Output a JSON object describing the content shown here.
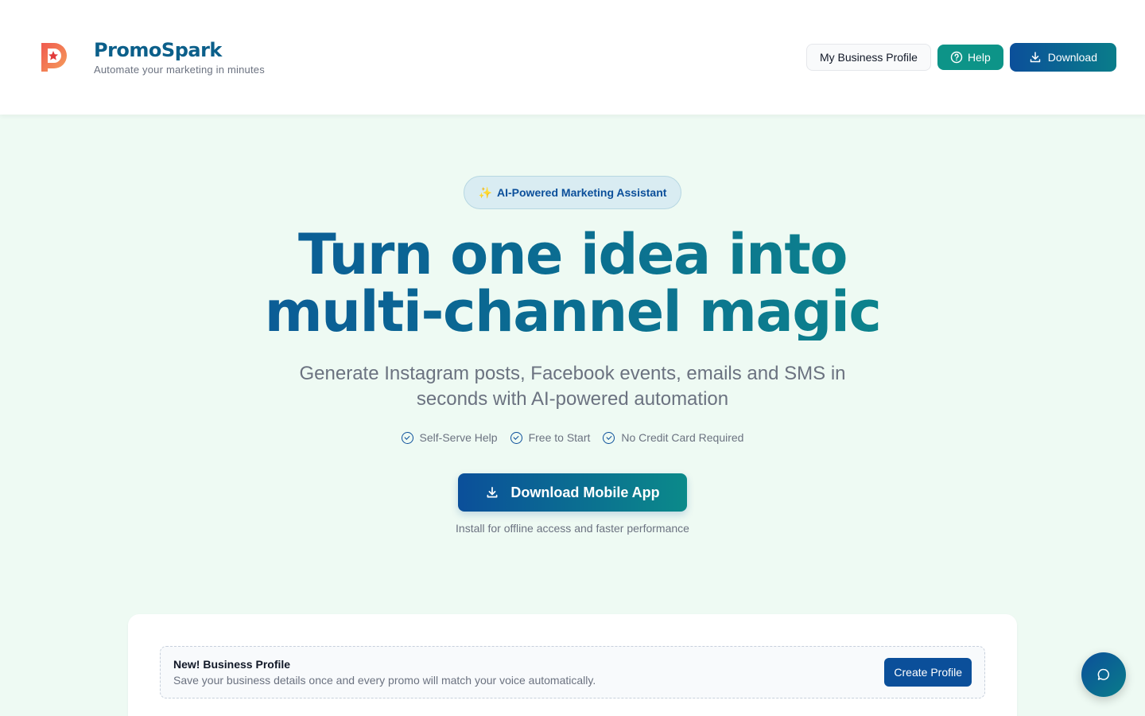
{
  "brand": {
    "name": "PromoSpark",
    "tagline": "Automate your marketing in minutes",
    "logo_icon": "p-star-logo-icon"
  },
  "header": {
    "profile_button": "My Business Profile",
    "help_button": "Help",
    "download_button": "Download"
  },
  "hero": {
    "badge": "AI-Powered Marketing Assistant",
    "badge_icon": "✨",
    "headline_line1": "Turn one idea into",
    "headline_line2": "multi-channel magic",
    "subhead": "Generate Instagram posts, Facebook events, emails and SMS in seconds with AI-powered automation",
    "features": [
      "Self-Serve Help",
      "Free to Start",
      "No Credit Card Required"
    ],
    "cta": "Download Mobile App",
    "cta_note": "Install for offline access and faster performance"
  },
  "notice": {
    "title": "New! Business Profile",
    "text": "Save your business details once and every promo will match your voice automatically.",
    "button": "Create Profile"
  },
  "colors": {
    "primary": "#0b4f9a",
    "accent": "#0d9488",
    "background": "#eefaf3"
  }
}
